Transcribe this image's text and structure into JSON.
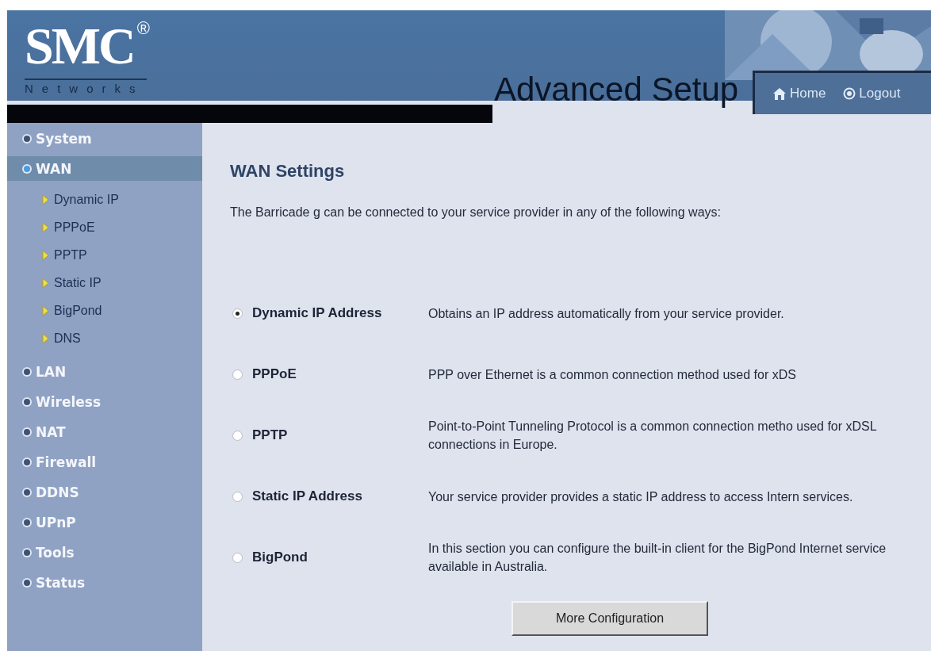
{
  "header": {
    "logo": "SMC",
    "logo_mark": "®",
    "logo_subtitle": "Networks",
    "title": "Advanced Setup",
    "links": [
      {
        "label": "Home",
        "kind": "home"
      },
      {
        "label": "Logout",
        "kind": "logout"
      }
    ]
  },
  "sidebar": {
    "items": [
      {
        "label": "System",
        "selected": false
      },
      {
        "label": "WAN",
        "selected": true,
        "children": [
          {
            "label": "Dynamic IP"
          },
          {
            "label": "PPPoE"
          },
          {
            "label": "PPTP"
          },
          {
            "label": "Static IP"
          },
          {
            "label": "BigPond"
          },
          {
            "label": "DNS"
          }
        ]
      },
      {
        "label": "LAN",
        "selected": false
      },
      {
        "label": "Wireless",
        "selected": false
      },
      {
        "label": "NAT",
        "selected": false
      },
      {
        "label": "Firewall",
        "selected": false
      },
      {
        "label": "DDNS",
        "selected": false
      },
      {
        "label": "UPnP",
        "selected": false
      },
      {
        "label": "Tools",
        "selected": false
      },
      {
        "label": "Status",
        "selected": false
      }
    ]
  },
  "main": {
    "title": "WAN Settings",
    "intro": "The Barricade g can be connected to your service provider in any of the following ways:",
    "options": [
      {
        "label": "Dynamic IP Address",
        "description": "Obtains an IP address automatically from your service provider.",
        "selected": true
      },
      {
        "label": "PPPoE",
        "description": "PPP over Ethernet is a common connection method used for xDS",
        "selected": false
      },
      {
        "label": "PPTP",
        "description": "Point-to-Point Tunneling Protocol is a common connection metho used for xDSL connections in Europe.",
        "selected": false
      },
      {
        "label": "Static IP Address",
        "description": "Your service provider provides a static IP address to access Intern services.",
        "selected": false
      },
      {
        "label": "BigPond",
        "description": "In this section you can configure the built-in client for the BigPond Internet service available in Australia.",
        "selected": false
      }
    ],
    "button": "More Configuration"
  }
}
